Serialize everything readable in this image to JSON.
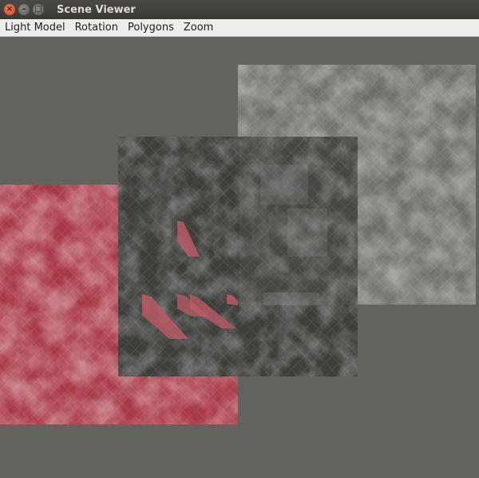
{
  "window": {
    "title": "Scene Viewer",
    "controls": {
      "close": "×",
      "minimize": "–",
      "maximize": "□"
    }
  },
  "menubar": {
    "items": [
      {
        "label": "Light Model"
      },
      {
        "label": "Rotation"
      },
      {
        "label": "Polygons"
      },
      {
        "label": "Zoom"
      }
    ]
  },
  "scene": {
    "background_color": "#62625e",
    "polygons": [
      {
        "name": "red-textured-polygon",
        "color": "#a83a48"
      },
      {
        "name": "dark-textured-polygon-front",
        "color": "#3a3a38"
      },
      {
        "name": "grey-textured-polygon-back",
        "color": "#7a7a76"
      }
    ]
  }
}
